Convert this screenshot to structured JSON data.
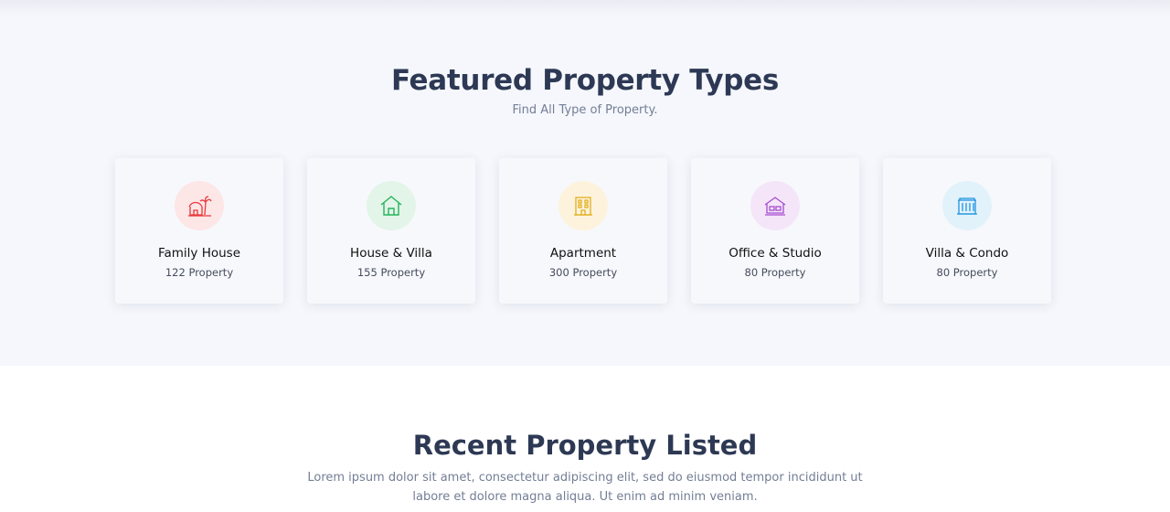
{
  "featured": {
    "title": "Featured Property Types",
    "subtitle": "Find All Type of Property.",
    "types": [
      {
        "name": "Family House",
        "count": "122 Property",
        "icon": "beach-house-icon",
        "color": "#e8383b",
        "bg": "#fde6e6"
      },
      {
        "name": "House & Villa",
        "count": "155 Property",
        "icon": "house-icon",
        "color": "#27b35a",
        "bg": "#e2f5e8"
      },
      {
        "name": "Apartment",
        "count": "300 Property",
        "icon": "apartment-icon",
        "color": "#e2ae20",
        "bg": "#fdf3dc"
      },
      {
        "name": "Office & Studio",
        "count": "80 Property",
        "icon": "office-icon",
        "color": "#a64dd0",
        "bg": "#f4e6f8"
      },
      {
        "name": "Villa & Condo",
        "count": "80 Property",
        "icon": "villa-condo-icon",
        "color": "#1e94e0",
        "bg": "#e2f2fb"
      }
    ]
  },
  "recent": {
    "title": "Recent Property Listed",
    "description": "Lorem ipsum dolor sit amet, consectetur adipiscing elit, sed do eiusmod tempor incididunt ut labore et dolore magna aliqua. Ut enim ad minim veniam."
  }
}
